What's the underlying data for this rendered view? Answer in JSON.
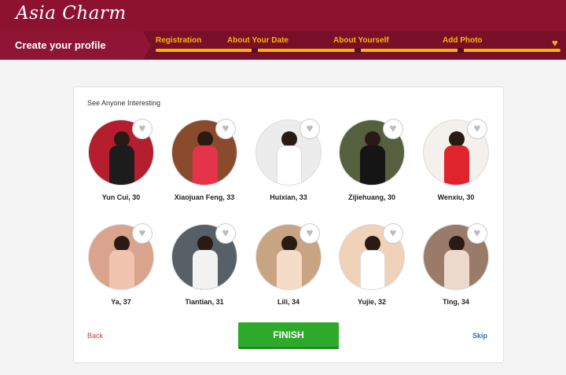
{
  "header": {
    "logo": "Asia Charm"
  },
  "stepbar": {
    "title": "Create your profile",
    "steps": [
      "Registration",
      "About Your Date",
      "About Yourself",
      "Add Photo"
    ],
    "heart_icon": "heart-icon"
  },
  "main": {
    "heading": "See Anyone Interesting",
    "profiles": [
      {
        "name": "Yun Cui, 30"
      },
      {
        "name": "Xiaojuan Feng, 33"
      },
      {
        "name": "Huixian, 33"
      },
      {
        "name": "Zijiehuang, 30"
      },
      {
        "name": "Wenxiu, 30"
      },
      {
        "name": "Ya, 37"
      },
      {
        "name": "Tiantian, 31"
      },
      {
        "name": "Lili, 34"
      },
      {
        "name": "Yujie, 32"
      },
      {
        "name": "Ting, 34"
      }
    ],
    "like_icon": "heart-icon"
  },
  "actions": {
    "back": "Back",
    "finish": "FINISH",
    "skip": "Skip"
  },
  "colors": {
    "brand": "#8c1230",
    "accent": "#f5b700",
    "finish": "#2eaa2a",
    "link": "#2a75b8",
    "back": "#d23a3a"
  }
}
